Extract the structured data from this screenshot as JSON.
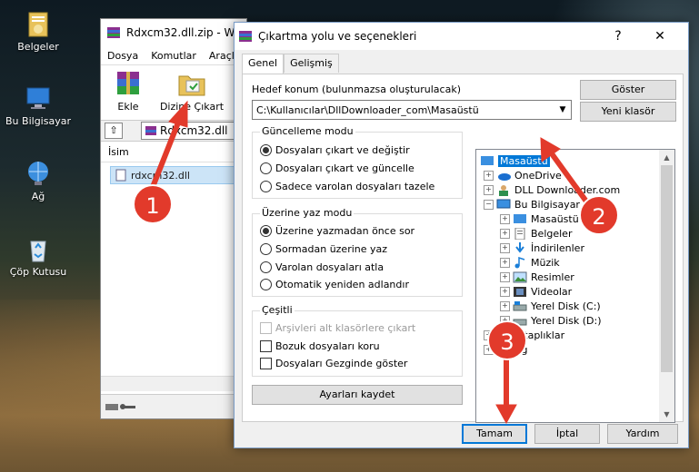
{
  "desktop": {
    "icons": [
      {
        "label": "Belgeler",
        "icon": "folder-documents-icon"
      },
      {
        "label": "Bu Bilgisayar",
        "icon": "computer-icon"
      },
      {
        "label": "Ağ",
        "icon": "network-icon"
      },
      {
        "label": "Çöp Kutusu",
        "icon": "recycle-bin-icon"
      }
    ]
  },
  "winrar": {
    "title": "Rdxcm32.dll.zip - W",
    "menu": [
      "Dosya",
      "Komutlar",
      "Araçla"
    ],
    "tools": [
      {
        "label": "Ekle",
        "icon": "winrar-add-icon"
      },
      {
        "label": "Dizine Çıkart",
        "icon": "extract-to-icon"
      }
    ],
    "path": "Rdxcm32.dll",
    "column_header": "İsim",
    "file": "rdxcm32.dll"
  },
  "dialog": {
    "title": "Çıkartma yolu ve seçenekleri",
    "help": "?",
    "close": "✕",
    "tabs": [
      "Genel",
      "Gelişmiş"
    ],
    "dest_label": "Hedef konum (bulunmazsa oluşturulacak)",
    "dest_value": "C:\\Kullanıcılar\\DllDownloader_com\\Masaüstü",
    "show_button": "Göster",
    "new_folder_button": "Yeni klasör",
    "update_mode": {
      "title": "Güncelleme modu",
      "options": [
        "Dosyaları çıkart ve değiştir",
        "Dosyaları çıkart ve güncelle",
        "Sadece varolan dosyaları tazele"
      ],
      "selected": 0
    },
    "overwrite_mode": {
      "title": "Üzerine yaz modu",
      "options": [
        "Üzerine yazmadan önce sor",
        "Sormadan üzerine yaz",
        "Varolan dosyaları atla",
        "Otomatik yeniden adlandır"
      ],
      "selected": 0
    },
    "misc": {
      "title": "Çeşitli",
      "options": [
        "Arşivleri alt klasörlere çıkart",
        "Bozuk dosyaları koru",
        "Dosyaları Gezginde göster"
      ],
      "disabled": [
        true,
        false,
        false
      ]
    },
    "save_settings_button": "Ayarları kaydet",
    "tree": [
      {
        "label": "Masaüstü",
        "icon": "desktop-folder-icon",
        "selected": true
      },
      {
        "label": "OneDrive",
        "icon": "onedrive-icon"
      },
      {
        "label": "DLL Downloader.com",
        "icon": "user-folder-icon"
      },
      {
        "label": "Bu Bilgisayar",
        "icon": "computer-icon"
      },
      {
        "label": "Masaüstü",
        "icon": "desktop-folder-icon"
      },
      {
        "label": "Belgeler",
        "icon": "documents-icon"
      },
      {
        "label": "İndirilenler",
        "icon": "downloads-icon"
      },
      {
        "label": "Müzik",
        "icon": "music-icon"
      },
      {
        "label": "Resimler",
        "icon": "pictures-icon"
      },
      {
        "label": "Videolar",
        "icon": "videos-icon"
      },
      {
        "label": "Yerel Disk (C:)",
        "icon": "drive-icon"
      },
      {
        "label": "Yerel Disk (D:)",
        "icon": "drive-icon"
      },
      {
        "label": "Kitaplıklar",
        "icon": "libraries-icon"
      },
      {
        "label": "Ağ",
        "icon": "network-icon"
      }
    ],
    "buttons": {
      "ok": "Tamam",
      "cancel": "İptal",
      "help": "Yardım"
    }
  },
  "callouts": [
    "1",
    "2",
    "3"
  ],
  "colors": {
    "callout": "#e23a2b",
    "selection": "#0078d7",
    "arrow": "#e23a2b"
  }
}
